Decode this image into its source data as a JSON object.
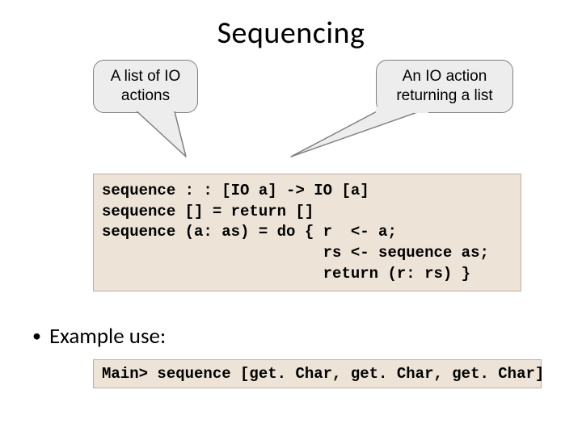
{
  "title": "Sequencing",
  "callout_left": "A list of IO actions",
  "callout_right": "An IO action returning a list",
  "code_main": "sequence : : [IO a] -> IO [a]\nsequence [] = return []\nsequence (a: as) = do { r  <- a;\n                        rs <- sequence as;\n                        return (r: rs) }",
  "bullet": "Example use:",
  "code_example": "Main> sequence [get. Char, get. Char, get. Char]"
}
